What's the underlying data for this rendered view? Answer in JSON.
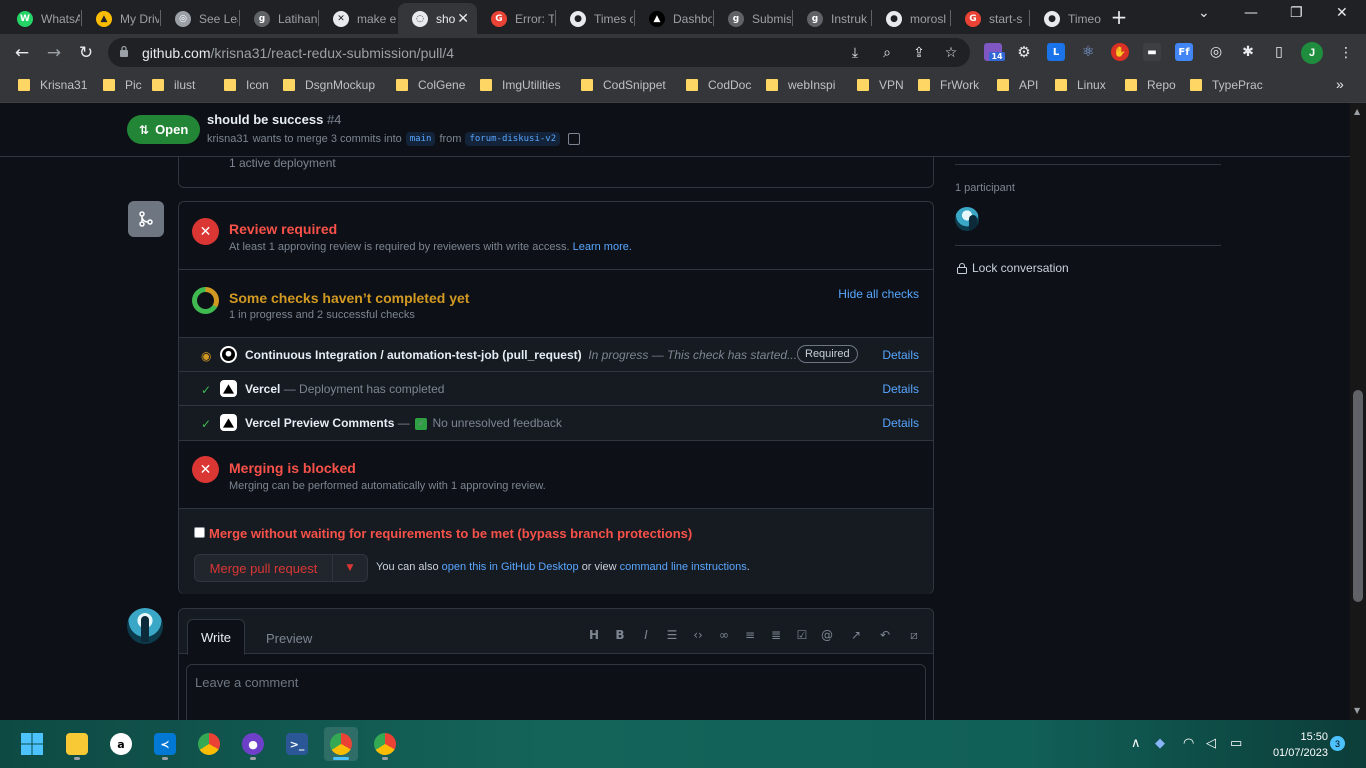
{
  "browser": {
    "tabs": [
      {
        "title": "WhatsApp",
        "favicon": "whatsapp-icon",
        "color": "#25d366",
        "glyph": "W"
      },
      {
        "title": "My Drive",
        "favicon": "drive-icon",
        "color": "#fbbc04",
        "glyph": "▲"
      },
      {
        "title": "See Lead",
        "favicon": "web-icon",
        "color": "#9aa0a6",
        "glyph": "◎"
      },
      {
        "title": "Latihan",
        "favicon": "g-icon",
        "color": "#5f6368",
        "glyph": "g"
      },
      {
        "title": "make e",
        "favicon": "error-github-icon",
        "color": "#e8eaed",
        "glyph": "✕"
      },
      {
        "title": "sho",
        "favicon": "github-loading-icon",
        "color": "#e8eaed",
        "glyph": "◌"
      },
      {
        "title": "Error: T",
        "favicon": "google-icon",
        "color": "#ea4335",
        "glyph": "G"
      },
      {
        "title": "Times c",
        "favicon": "github-icon",
        "color": "#e8eaed",
        "glyph": "●"
      },
      {
        "title": "Dashbo",
        "favicon": "vercel-icon",
        "color": "#000000",
        "glyph": "▲"
      },
      {
        "title": "Submis",
        "favicon": "g-icon",
        "color": "#5f6368",
        "glyph": "g"
      },
      {
        "title": "Instruk",
        "favicon": "g-icon",
        "color": "#5f6368",
        "glyph": "g"
      },
      {
        "title": "morosl",
        "favicon": "github-icon",
        "color": "#e8eaed",
        "glyph": "●"
      },
      {
        "title": "start-s",
        "favicon": "google-icon",
        "color": "#ea4335",
        "glyph": "G"
      },
      {
        "title": "Timeo",
        "favicon": "github-icon",
        "color": "#e8eaed",
        "glyph": "●"
      }
    ],
    "url_host": "github.com",
    "url_path": "/krisna31/react-redux-submission/pull/4",
    "profile_initial": "J",
    "extension_badge": "14",
    "bookmarks": [
      "Krisna31",
      "Pic",
      "ilust",
      "Icon",
      "DsgnMockup",
      "ColGene",
      "ImgUtilities",
      "CodSnippet",
      "CodDoc",
      "webInspi",
      "VPN",
      "FrWork",
      "API",
      "Linux",
      "Repo",
      "TypePrac"
    ]
  },
  "pr": {
    "state": "Open",
    "title": "should be success",
    "number": "#4",
    "author": "krisna31",
    "meta_mid": "wants to merge 3 commits into",
    "base_branch": "main",
    "meta_from": "from",
    "head_branch": "forum-diskusi-v2",
    "deployment_text": "1 active deployment"
  },
  "merge": {
    "review_title": "Review required",
    "review_sub": "At least 1 approving review is required by reviewers with write access.",
    "learn_more": "Learn more.",
    "checks_title": "Some checks haven’t completed yet",
    "checks_sub": "1 in progress and 2 successful checks",
    "hide_checks": "Hide all checks",
    "checks": [
      {
        "name": "Continuous Integration / automation-test-job (pull_request)",
        "status": "In progress — This check has started...",
        "badge": "Required",
        "details": "Details"
      },
      {
        "name": "Vercel",
        "status": "— Deployment has completed",
        "details": "Details"
      },
      {
        "name": "Vercel Preview Comments",
        "sep": "—",
        "status": "No unresolved feedback",
        "details": "Details"
      }
    ],
    "blocked_title": "Merging is blocked",
    "blocked_sub": "Merging can be performed automatically with 1 approving review.",
    "bypass_label": "Merge without waiting for requirements to be met (bypass branch protections)",
    "merge_button": "Merge pull request",
    "also_prefix": "You can also",
    "desktop_link": "open this in GitHub Desktop",
    "or_view": "or view",
    "cli_link": "command line instructions",
    "cli_suffix": "."
  },
  "comment": {
    "write_tab": "Write",
    "preview_tab": "Preview",
    "placeholder": "Leave a comment"
  },
  "sidebar": {
    "participants": "1 participant",
    "lock": "Lock conversation"
  },
  "taskbar": {
    "time": "15:50",
    "date": "01/07/2023",
    "notifications": "3"
  }
}
